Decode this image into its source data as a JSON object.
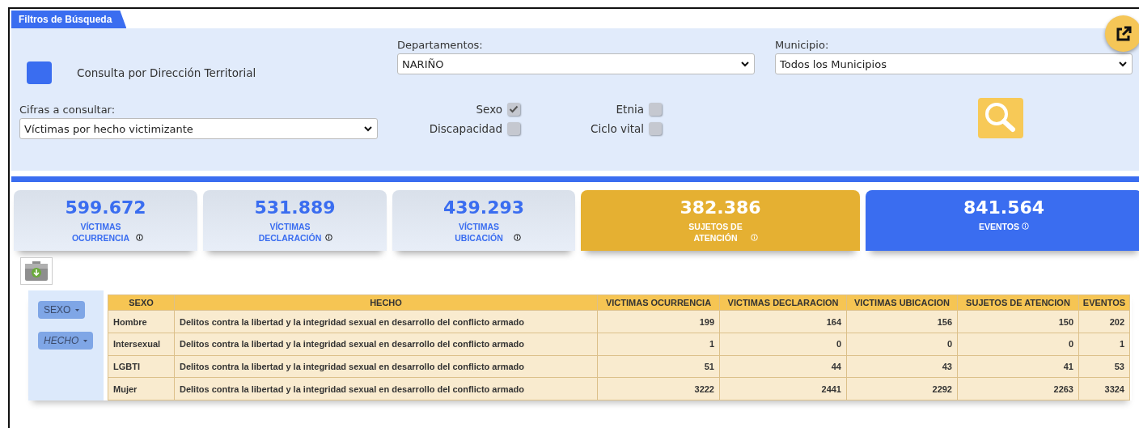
{
  "filters": {
    "tab": "Filtros de Búsqueda",
    "territorial": {
      "label": "Consulta por Dirección Territorial"
    },
    "departamentos": {
      "label": "Departamentos:",
      "value": "NARIÑO"
    },
    "municipio": {
      "label": "Municipio:",
      "value": "Todos los Municipios"
    },
    "cifras": {
      "label": "Cifras a consultar:",
      "value": "Víctimas por hecho victimizante"
    },
    "checkboxes": [
      {
        "label": "Sexo",
        "checked": true
      },
      {
        "label": "Etnia",
        "checked": false
      },
      {
        "label": "Discapacidad",
        "checked": false
      },
      {
        "label": "Ciclo vital",
        "checked": false
      }
    ]
  },
  "cards": [
    {
      "kind": "soft",
      "value": "599.672",
      "label": "VÍCTIMAS OCURRENCIA"
    },
    {
      "kind": "soft",
      "value": "531.889",
      "label": "VÍCTIMAS DECLARACIÓN"
    },
    {
      "kind": "soft",
      "value": "439.293",
      "label": "VÍCTIMAS UBICACIÓN"
    },
    {
      "kind": "gold",
      "value": "382.386",
      "label": "SUJETOS DE ATENCIÓN"
    },
    {
      "kind": "blue",
      "value": "841.564",
      "label": "EVENTOS"
    }
  ],
  "pivot": {
    "fields": [
      {
        "label": "SEXO",
        "filtered": false
      },
      {
        "label": "HECHO",
        "filtered": true
      }
    ],
    "table": {
      "columns": [
        "SEXO",
        "HECHO",
        "VICTIMAS OCURRENCIA",
        "VICTIMAS DECLARACION",
        "VICTIMAS UBICACION",
        "SUJETOS DE ATENCION",
        "EVENTOS"
      ],
      "rows": [
        [
          "Hombre",
          "Delitos contra la libertad y la integridad sexual en desarrollo del conflicto armado",
          "199",
          "164",
          "156",
          "150",
          "202"
        ],
        [
          "Intersexual",
          "Delitos contra la libertad y la integridad sexual en desarrollo del conflicto armado",
          "1",
          "0",
          "0",
          "0",
          "1"
        ],
        [
          "LGBTI",
          "Delitos contra la libertad y la integridad sexual en desarrollo del conflicto armado",
          "51",
          "44",
          "43",
          "41",
          "53"
        ],
        [
          "Mujer",
          "Delitos contra la libertad y la integridad sexual en desarrollo del conflicto armado",
          "3222",
          "2441",
          "2292",
          "2263",
          "3324"
        ]
      ]
    }
  }
}
